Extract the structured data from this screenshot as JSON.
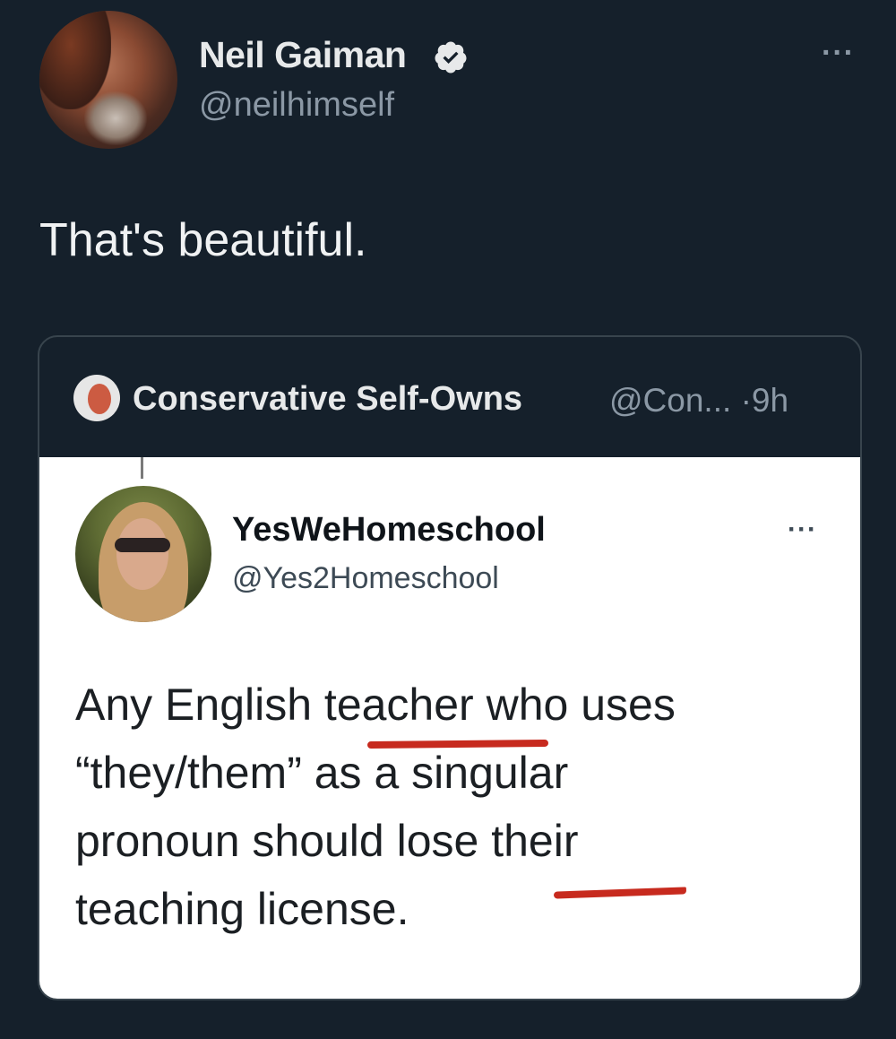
{
  "tweet": {
    "author_name": "Neil Gaiman",
    "author_handle": "@neilhimself",
    "verified": true,
    "text": "That's beautiful.",
    "more_icon": "ellipsis-icon"
  },
  "quote": {
    "author_name": "Conservative Self-Owns",
    "handle_truncated": "@Con...",
    "separator": "·",
    "time": "9h",
    "screenshot": {
      "author_name": "YesWeHomeschool",
      "author_handle": "@Yes2Homeschool",
      "text_lines": [
        "Any English teacher who uses",
        "“they/them” as a singular",
        "pronoun should lose their",
        "teaching license."
      ],
      "underline_color": "#c72a1e"
    }
  },
  "colors": {
    "background": "#15202b",
    "text_primary": "#e7e9ea",
    "text_secondary": "#8b98a5",
    "verified": "#e7e9ea"
  }
}
